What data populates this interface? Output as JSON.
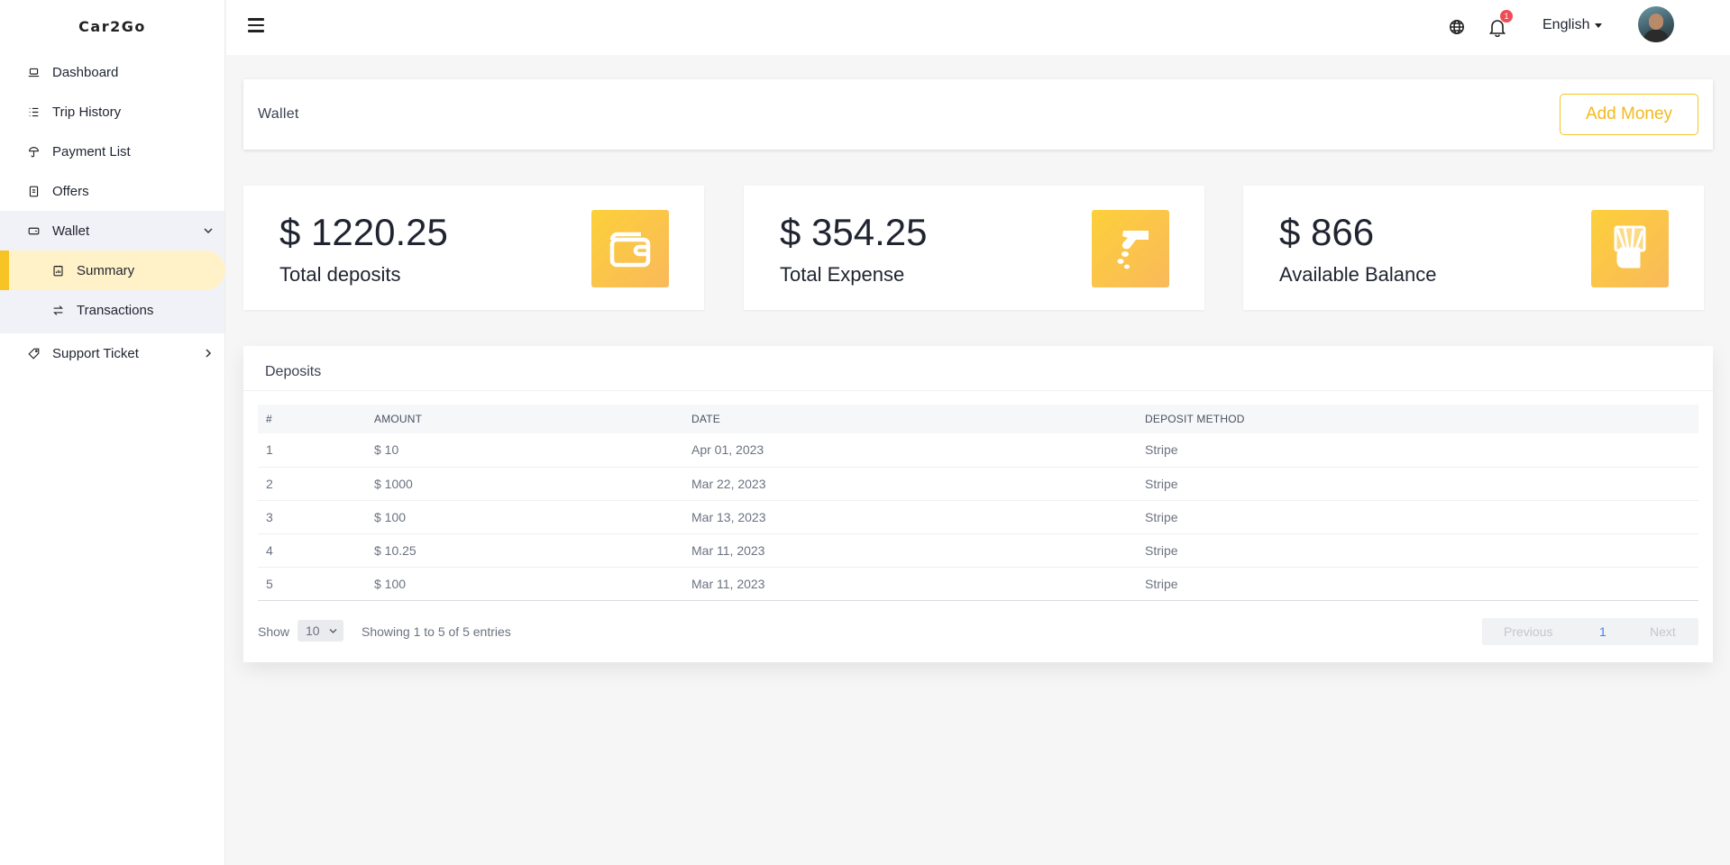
{
  "brand": "Car2Go",
  "sidebar": {
    "items": [
      {
        "label": "Dashboard",
        "icon": "laptop-icon"
      },
      {
        "label": "Trip History",
        "icon": "list-icon"
      },
      {
        "label": "Payment List",
        "icon": "umbrella-icon"
      },
      {
        "label": "Offers",
        "icon": "document-icon"
      },
      {
        "label": "Wallet",
        "icon": "wallet-icon",
        "expanded": true
      },
      {
        "label": "Support Ticket",
        "icon": "tag-icon"
      }
    ],
    "wallet_sub": [
      {
        "label": "Summary",
        "icon": "report-icon",
        "active": true
      },
      {
        "label": "Transactions",
        "icon": "swap-icon"
      }
    ]
  },
  "topbar": {
    "notification_count": "1",
    "language": "English"
  },
  "wallet": {
    "title": "Wallet",
    "add_money_label": "Add Money"
  },
  "stats": [
    {
      "value": "$ 1220.25",
      "label": "Total deposits",
      "icon": "wallet-icon"
    },
    {
      "value": "$ 354.25",
      "label": "Total Expense",
      "icon": "hand-coins-icon"
    },
    {
      "value": "$ 866",
      "label": "Available Balance",
      "icon": "money-hand-icon"
    }
  ],
  "deposits": {
    "title": "Deposits",
    "columns": [
      "#",
      "AMOUNT",
      "DATE",
      "DEPOSIT METHOD"
    ],
    "rows": [
      [
        "1",
        "$ 10",
        "Apr 01, 2023",
        "Stripe"
      ],
      [
        "2",
        "$ 1000",
        "Mar 22, 2023",
        "Stripe"
      ],
      [
        "3",
        "$ 100",
        "Mar 13, 2023",
        "Stripe"
      ],
      [
        "4",
        "$ 10.25",
        "Mar 11, 2023",
        "Stripe"
      ],
      [
        "5",
        "$ 100",
        "Mar 11, 2023",
        "Stripe"
      ]
    ],
    "show_label": "Show",
    "page_size": "10",
    "info": "Showing 1 to 5 of 5 entries",
    "prev_label": "Previous",
    "current_page": "1",
    "next_label": "Next"
  },
  "colors": {
    "accent": "#f7c325",
    "active_bg": "#fff2c8",
    "badge": "#ef4d56"
  }
}
